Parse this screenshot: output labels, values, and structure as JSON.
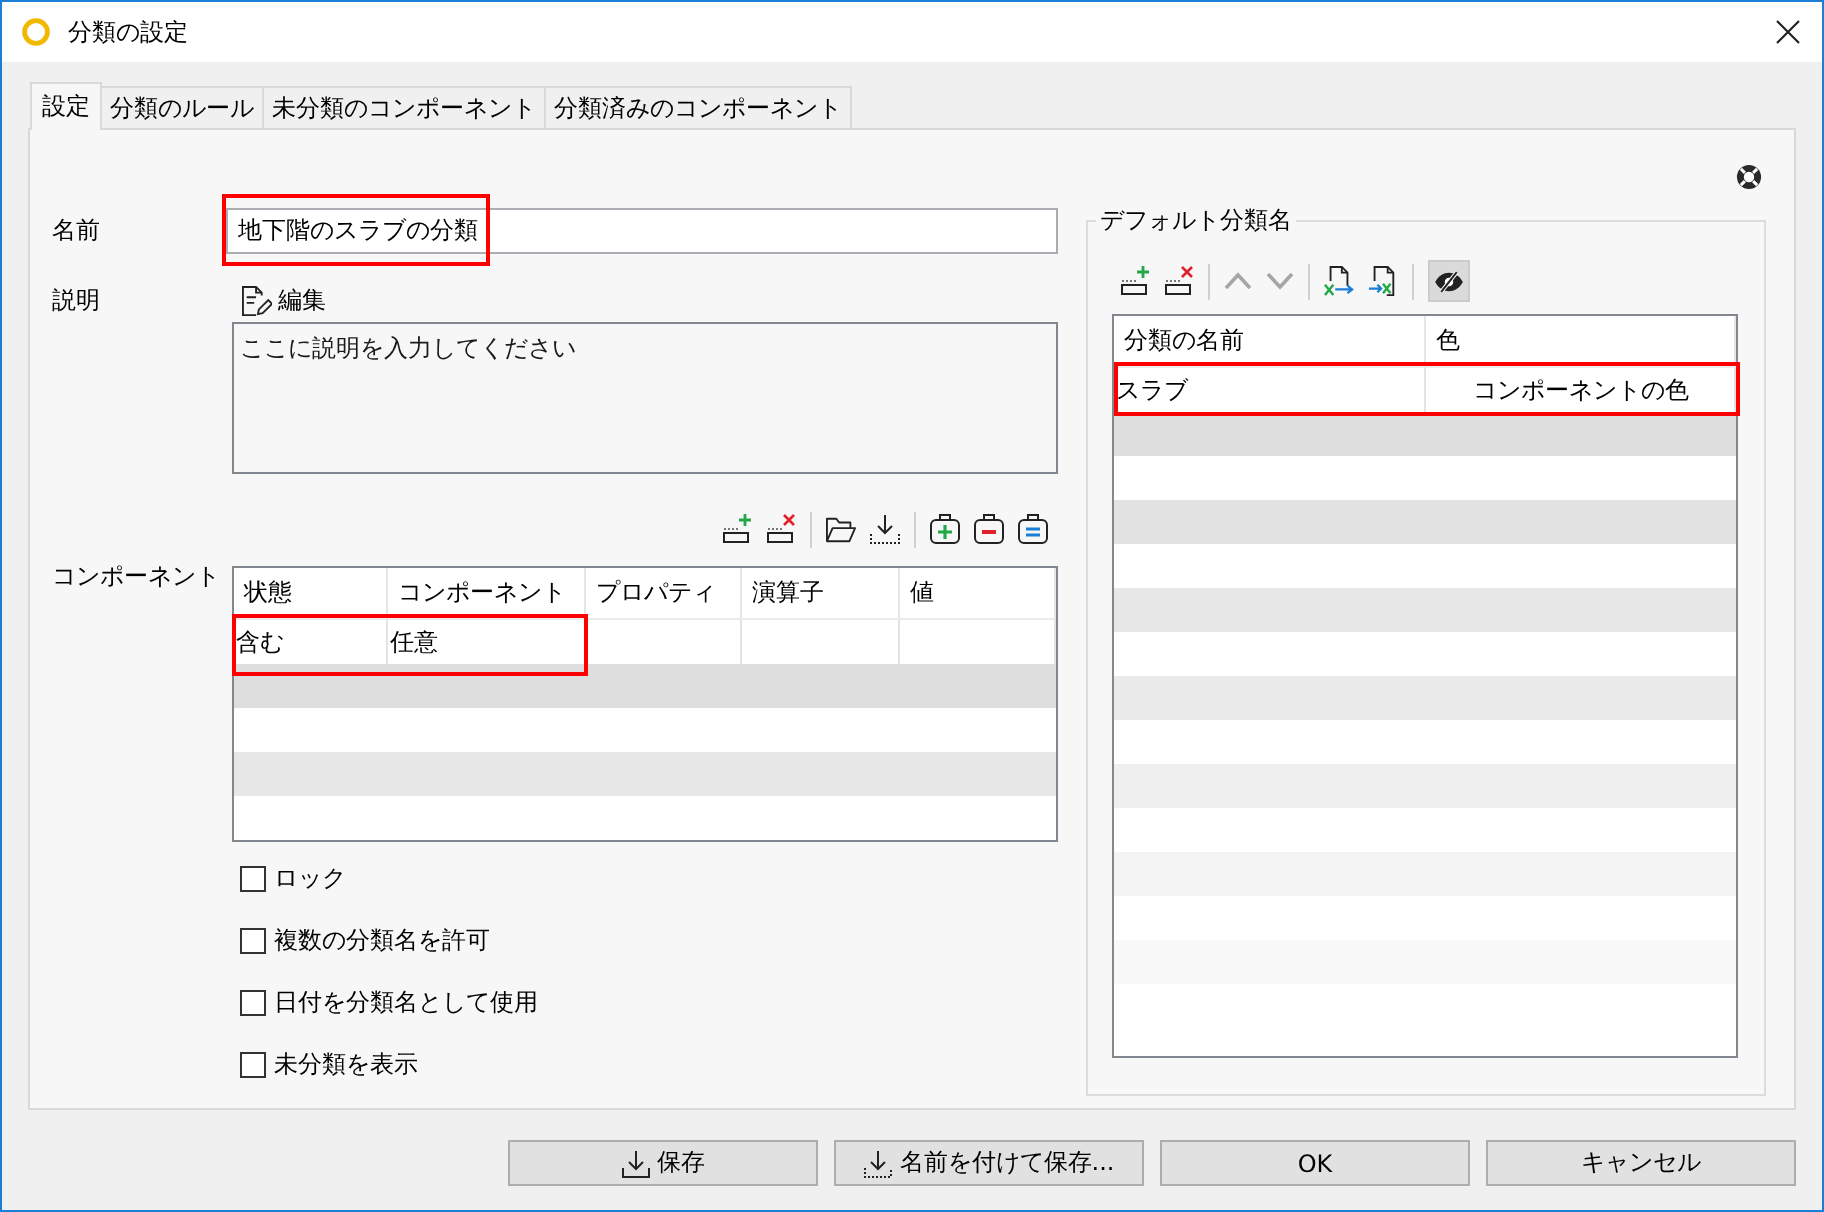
{
  "window": {
    "title": "分類の設定"
  },
  "tabs": [
    {
      "label": "設定",
      "selected": true
    },
    {
      "label": "分類のルール",
      "selected": false
    },
    {
      "label": "未分類のコンポーネント",
      "selected": false
    },
    {
      "label": "分類済みのコンポーネント",
      "selected": false
    }
  ],
  "settings": {
    "name": {
      "label": "名前",
      "value": "地下階のスラブの分類",
      "highlighted": true
    },
    "description": {
      "label": "説明",
      "edit": "編集",
      "placeholder": "ここに説明を入力してください"
    },
    "components": {
      "label": "コンポーネント",
      "table": {
        "columns": [
          "状態",
          "コンポーネント",
          "プロパティ",
          "演算子",
          "値"
        ],
        "rows": [
          {
            "cells": [
              "含む",
              "任意"
            ],
            "highlighted": true
          }
        ]
      }
    },
    "checkboxes": [
      {
        "label": "ロック",
        "checked": false
      },
      {
        "label": "複数の分類名を許可",
        "checked": false
      },
      {
        "label": "日付を分類名として使用",
        "checked": false
      },
      {
        "label": "未分類を表示",
        "checked": false
      }
    ]
  },
  "default_names": {
    "legend": "デフォルト分類名",
    "toolbar": {
      "move_up_disabled": true,
      "move_down_disabled": true,
      "hide_toggle_on": true
    },
    "table": {
      "columns": [
        "分類の名前",
        "色"
      ],
      "rows": [
        {
          "cells": [
            "スラブ",
            "コンポーネントの色"
          ],
          "highlighted": true
        }
      ]
    }
  },
  "buttons": [
    {
      "label": "保存",
      "kind": "save"
    },
    {
      "label": "名前を付けて保存...",
      "kind": "save-as"
    },
    {
      "label": "OK",
      "kind": "confirm"
    },
    {
      "label": "キャンセル",
      "kind": "cancel"
    }
  ]
}
